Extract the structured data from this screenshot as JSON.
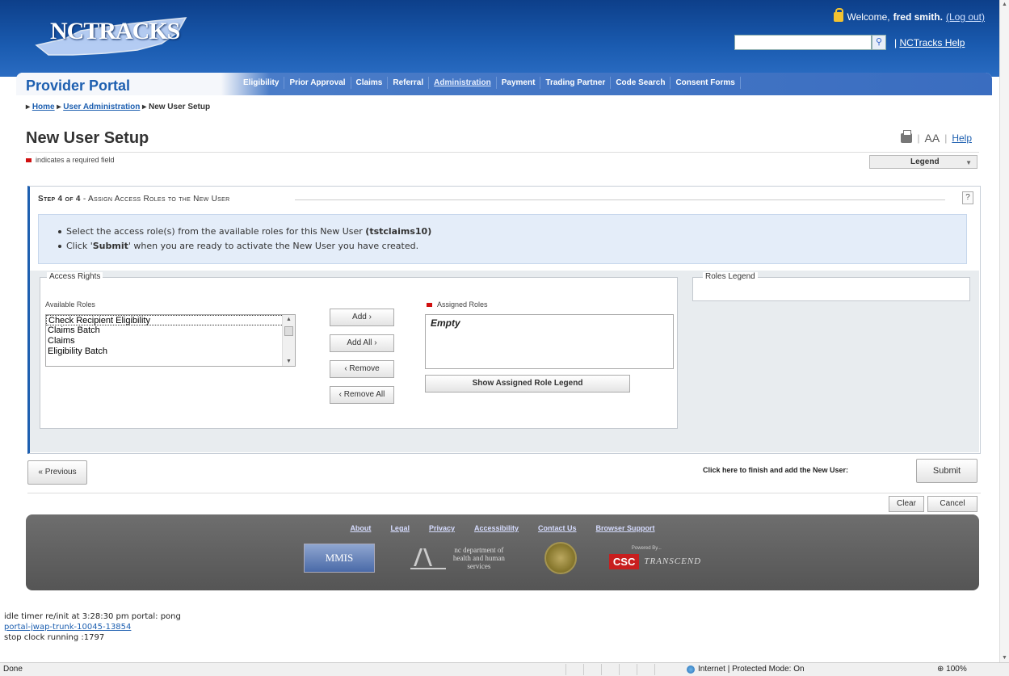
{
  "header": {
    "logo_text": "NCTRACKS",
    "welcome_prefix": "Welcome,",
    "user_name": "fred smith.",
    "logout_label": "(Log out)",
    "search_icon": "magnifier",
    "help_sep": "|",
    "help_label": "NCTracks Help"
  },
  "portal": {
    "title": "Provider Portal",
    "nav": [
      {
        "label": "Eligibility",
        "active": false
      },
      {
        "label": "Prior Approval",
        "active": false
      },
      {
        "label": "Claims",
        "active": false
      },
      {
        "label": "Referral",
        "active": false
      },
      {
        "label": "Administration",
        "active": true
      },
      {
        "label": "Payment",
        "active": false
      },
      {
        "label": "Trading Partner",
        "active": false
      },
      {
        "label": "Code Search",
        "active": false
      },
      {
        "label": "Consent Forms",
        "active": false
      }
    ]
  },
  "breadcrumb": {
    "home": "Home",
    "user_admin": "User Administration",
    "current": "New User Setup"
  },
  "page": {
    "title": "New User Setup",
    "font_size_label": "AA",
    "help_label": "Help",
    "required_note": "indicates a required field",
    "legend_select": "Legend"
  },
  "step": {
    "number": "Step 4 of 4",
    "description": "- Assign Access Roles to the New User",
    "help_q": "?",
    "info_line1_prefix": "Select the access role(s) from the available roles for this New User",
    "info_line1_user": "(tstclaims10)",
    "info_line2_prefix": "Click '",
    "info_line2_bold": "Submit",
    "info_line2_suffix": "' when you are ready to activate the New User you have created."
  },
  "access": {
    "title": "Access Rights",
    "available_label": "Available Roles",
    "available_roles": [
      "Check Recipient Eligibility",
      "Claims Batch",
      "Claims",
      "Eligibility Batch"
    ],
    "add_label": "Add ›",
    "add_all_label": "Add All ›",
    "remove_label": "‹ Remove",
    "remove_all_label": "‹ Remove All",
    "assigned_label": "Assigned Roles",
    "assigned_empty": "Empty",
    "show_legend_label": "Show Assigned Role Legend"
  },
  "roles_legend": {
    "title": "Roles Legend"
  },
  "actions": {
    "previous_label": "« Previous",
    "finish_text": "Click here to finish and add the New User:",
    "submit_label": "Submit",
    "clear_label": "Clear",
    "cancel_label": "Cancel"
  },
  "footer": {
    "links": [
      "About",
      "Legal",
      "Privacy",
      "Accessibility",
      "Contact Us",
      "Browser Support"
    ],
    "mmis": "MMIS",
    "dhhs_text": "nc department of health and human services",
    "powered_by": "Powered By...",
    "csc": "CSC",
    "transcend": "TRANSCEND"
  },
  "debug": {
    "line1": "idle timer re/init at 3:28:30 pm  portal: pong",
    "line2": "portal-jwap-trunk-10045-13854",
    "line3": "stop clock running :1797"
  },
  "status": {
    "done": "Done",
    "zone": "Internet | Protected Mode: On",
    "zoom": "⊕ 100%"
  },
  "colors": {
    "banner": "#1a5bb0",
    "portal_accent": "#1d5fb0",
    "required": "#d01010",
    "info_panel": "#e4edf9",
    "footer": "#5e5e5e"
  }
}
